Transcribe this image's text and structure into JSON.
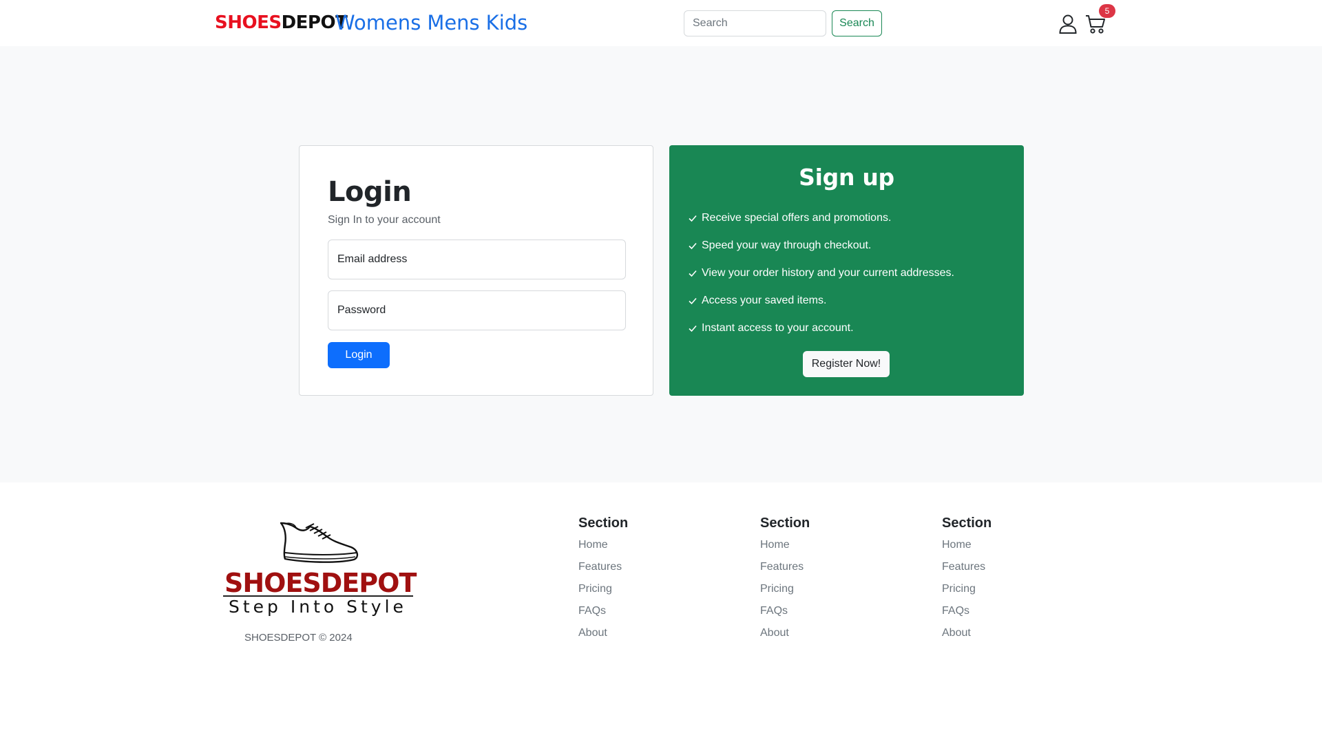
{
  "navbar": {
    "brand_part1": "SHOES",
    "brand_part2": "DEPOT",
    "links": [
      "Womens",
      "Mens",
      "Kids"
    ],
    "search_placeholder": "Search",
    "search_button": "Search",
    "user_icon": "user-icon",
    "cart_icon": "cart-icon",
    "cart_count": "5"
  },
  "login": {
    "title": "Login",
    "subtitle": "Sign In to your account",
    "email_placeholder": "Email address",
    "password_placeholder": "Password",
    "button": "Login"
  },
  "signup": {
    "title": "Sign up",
    "benefits": [
      "Receive special offers and promotions.",
      "Speed your way through checkout.",
      "View your order history and your current addresses.",
      "Access your saved items.",
      "Instant access to your account."
    ],
    "button": "Register Now!"
  },
  "footer": {
    "logo_text": "SHOESDEPOT",
    "logo_tagline": "Step Into Style",
    "copyright": "SHOESDEPOT © 2024",
    "columns": [
      {
        "title": "Section",
        "links": [
          "Home",
          "Features",
          "Pricing",
          "FAQs",
          "About"
        ]
      },
      {
        "title": "Section",
        "links": [
          "Home",
          "Features",
          "Pricing",
          "FAQs",
          "About"
        ]
      },
      {
        "title": "Section",
        "links": [
          "Home",
          "Features",
          "Pricing",
          "FAQs",
          "About"
        ]
      }
    ]
  },
  "colors": {
    "brand_red": "#e8101f",
    "link_blue": "#1a6fe6",
    "primary": "#0d6efd",
    "success": "#198754",
    "badge_red": "#dc3545"
  }
}
